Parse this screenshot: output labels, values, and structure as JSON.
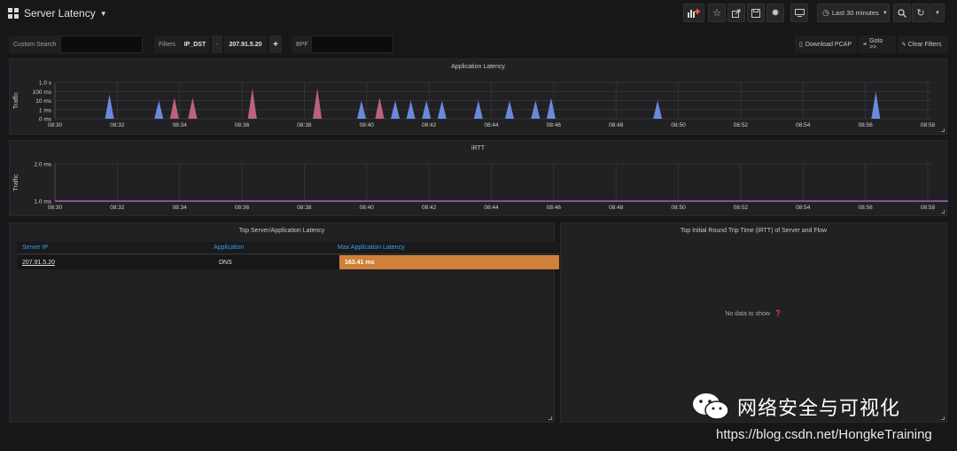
{
  "header": {
    "title": "Server Latency",
    "timepicker_label": "Last 30 minutes"
  },
  "filters": {
    "custom_search_label": "Custom Search",
    "custom_search_value": "",
    "filters_label": "Filters",
    "filter_field": "IP_DST",
    "filter_minus": "-",
    "filter_value": "207.91.5.20",
    "filter_plus": "+",
    "bpf_label": "BPF",
    "bpf_value": "",
    "download_pcap": "Download PCAP",
    "goto": "Goto >>",
    "clear_filters": "Clear Filters"
  },
  "panels": {
    "app_latency_title": "Application Latency",
    "irtt_title": "iRTT",
    "top_server_title": "Top Server/Application Latency",
    "top_irtt_title": "Top Initial Round Trip Time (iRTT) of Server and Flow",
    "no_data": "No data to show"
  },
  "table": {
    "headers": [
      "Server IP",
      "Application",
      "Max Application Latency"
    ],
    "rows": [
      [
        "207.91.5.20",
        "DNS",
        "163.41 ms"
      ]
    ]
  },
  "watermark": {
    "text": "网络安全与可视化",
    "url": "https://blog.csdn.net/HongkeTraining"
  },
  "colors": {
    "series_blue": "#6e8fe6",
    "series_red": "#d9545c",
    "series_pink": "#c86dd7",
    "highlight_cell": "#cf813a",
    "link_header": "#33a2e5"
  },
  "chart_data": [
    {
      "type": "area",
      "title": "Application Latency",
      "ylabel": "Traffic",
      "y_scale": "log",
      "y_ticks": [
        "0 ms",
        "1 ms",
        "10 ms",
        "100 ms",
        "1.0 s"
      ],
      "x_ticks": [
        "08:30",
        "08:32",
        "08:34",
        "08:36",
        "08:38",
        "08:40",
        "08:42",
        "08:44",
        "08:46",
        "08:48",
        "08:50",
        "08:52",
        "08:54",
        "08:56",
        "08:58"
      ],
      "grid": true,
      "series": [
        {
          "color": "#6e8fe6",
          "x": [
            "08:31:45",
            "08:33:20",
            "08:33:50",
            "08:34:25",
            "08:36:20",
            "08:38:25",
            "08:39:50",
            "08:40:25",
            "08:40:55",
            "08:41:25",
            "08:41:55",
            "08:42:25",
            "08:43:35",
            "08:44:35",
            "08:45:25",
            "08:45:55",
            "08:49:20",
            "08:56:20"
          ],
          "y_ms": [
            50,
            10,
            20,
            20,
            200,
            200,
            10,
            20,
            10,
            10,
            10,
            10,
            10,
            10,
            10,
            20,
            10,
            100
          ]
        },
        {
          "color": "#d9545c",
          "x": [
            "08:33:50",
            "08:34:25",
            "08:36:20",
            "08:38:25",
            "08:40:25"
          ],
          "y_ms": [
            20,
            20,
            200,
            200,
            20
          ]
        }
      ]
    },
    {
      "type": "line",
      "title": "iRTT",
      "ylabel": "Traffic",
      "y_ticks": [
        "1.0 ms",
        "2.0 ms"
      ],
      "x_ticks": [
        "08:30",
        "08:32",
        "08:34",
        "08:36",
        "08:38",
        "08:40",
        "08:42",
        "08:44",
        "08:46",
        "08:48",
        "08:50",
        "08:52",
        "08:54",
        "08:56",
        "08:58"
      ],
      "grid": true,
      "series": [
        {
          "color": "#c86dd7",
          "x": [
            "08:30",
            "08:59"
          ],
          "y_ms": [
            1.0,
            1.0
          ]
        }
      ]
    }
  ]
}
